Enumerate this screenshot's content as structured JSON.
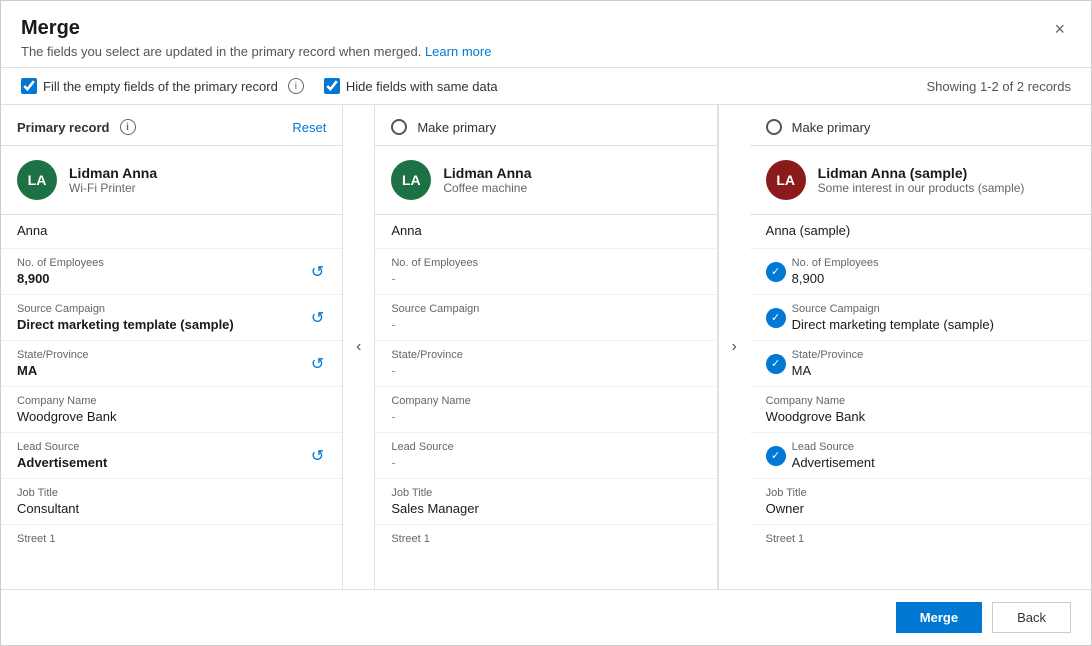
{
  "dialog": {
    "title": "Merge",
    "subtitle": "The fields you select are updated in the primary record when merged.",
    "learn_more": "Learn more",
    "close_label": "×"
  },
  "toolbar": {
    "checkbox1_label": "Fill the empty fields of the primary record",
    "checkbox2_label": "Hide fields with same data",
    "showing_text": "Showing 1-2 of 2 records"
  },
  "columns": [
    {
      "type": "primary",
      "header_label": "Primary record",
      "reset_label": "Reset",
      "avatar_initials": "LA",
      "avatar_color": "green",
      "record_name": "Lidman Anna",
      "record_sub": "Wi-Fi Printer",
      "first_name": "Anna",
      "fields": [
        {
          "label": "No. of Employees",
          "value": "8,900",
          "bold": true,
          "has_reset": true
        },
        {
          "label": "Source Campaign",
          "value": "Direct marketing template (sample)",
          "bold": true,
          "has_reset": true
        },
        {
          "label": "State/Province",
          "value": "MA",
          "bold": true,
          "has_reset": true
        },
        {
          "label": "Company Name",
          "value": "Woodgrove Bank",
          "bold": false,
          "has_reset": false
        },
        {
          "label": "Lead Source",
          "value": "Advertisement",
          "bold": true,
          "has_reset": true
        },
        {
          "label": "Job Title",
          "value": "Consultant",
          "bold": false,
          "has_reset": false
        },
        {
          "label": "Street 1",
          "value": "",
          "bold": false,
          "has_reset": false
        }
      ]
    },
    {
      "type": "secondary",
      "header_label": "Make primary",
      "avatar_initials": "LA",
      "avatar_color": "green",
      "record_name": "Lidman Anna",
      "record_sub": "Coffee machine",
      "first_name": "Anna",
      "fields": [
        {
          "label": "No. of Employees",
          "value": "-",
          "dash": true
        },
        {
          "label": "Source Campaign",
          "value": "-",
          "dash": true
        },
        {
          "label": "State/Province",
          "value": "-",
          "dash": true
        },
        {
          "label": "Company Name",
          "value": "-",
          "dash": true
        },
        {
          "label": "Lead Source",
          "value": "-",
          "dash": true
        },
        {
          "label": "Job Title",
          "value": "Sales Manager",
          "dash": false
        },
        {
          "label": "Street 1",
          "value": "",
          "dash": false
        }
      ]
    },
    {
      "type": "secondary",
      "header_label": "Make primary",
      "avatar_initials": "LA",
      "avatar_color": "red",
      "record_name": "Lidman Anna (sample)",
      "record_sub": "Some interest in our products (sample)",
      "first_name": "Anna (sample)",
      "fields": [
        {
          "label": "No. of Employees",
          "value": "8,900",
          "has_check": true
        },
        {
          "label": "Source Campaign",
          "value": "Direct marketing template (sample)",
          "has_check": true
        },
        {
          "label": "State/Province",
          "value": "MA",
          "has_check": true
        },
        {
          "label": "Company Name",
          "value": "Woodgrove Bank",
          "has_check": false
        },
        {
          "label": "Lead Source",
          "value": "Advertisement",
          "has_check": true
        },
        {
          "label": "Job Title",
          "value": "Owner",
          "has_check": false
        },
        {
          "label": "Street 1",
          "value": "",
          "has_check": false
        }
      ]
    }
  ],
  "footer": {
    "merge_label": "Merge",
    "back_label": "Back"
  }
}
